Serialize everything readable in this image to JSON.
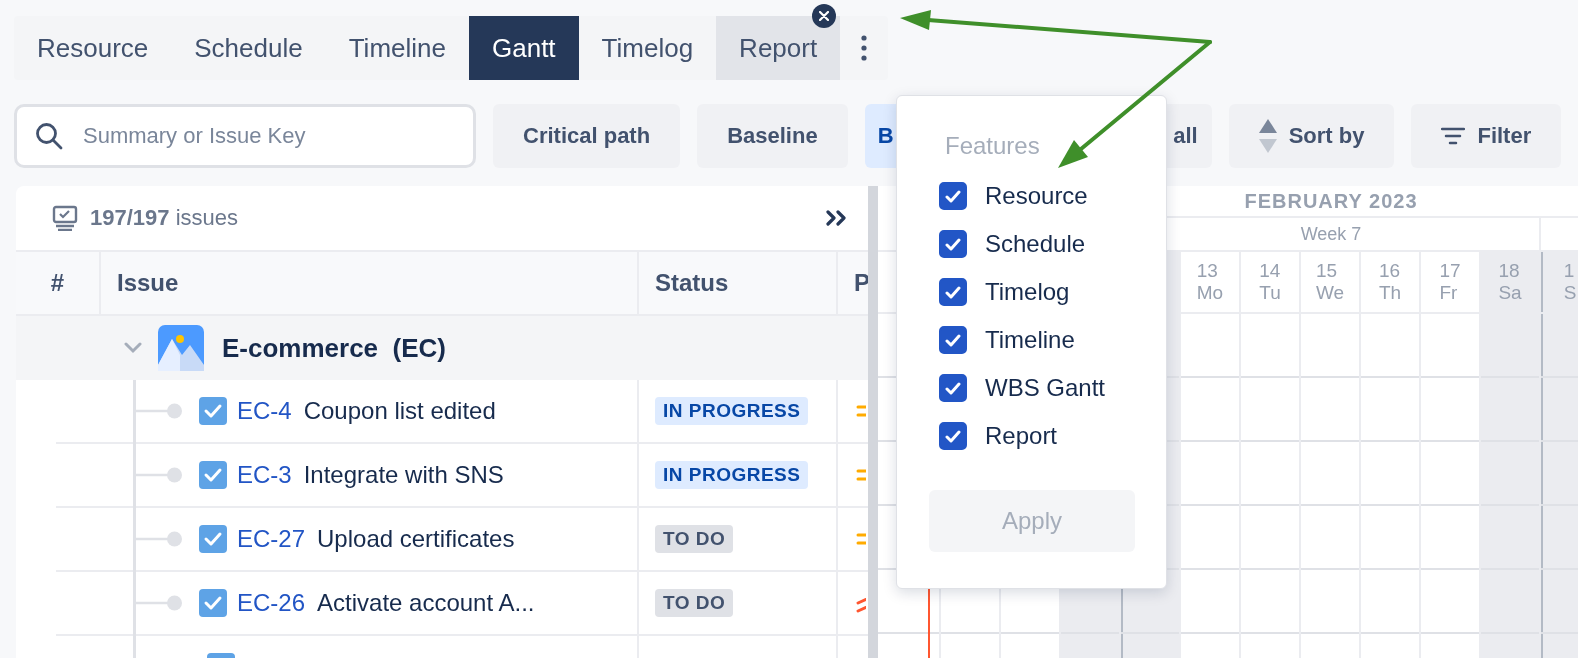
{
  "tabs": [
    {
      "label": "Resource",
      "selected": false,
      "closable": false
    },
    {
      "label": "Schedule",
      "selected": false,
      "closable": false
    },
    {
      "label": "Timeline",
      "selected": false,
      "closable": false
    },
    {
      "label": "Gantt",
      "selected": true,
      "closable": false
    },
    {
      "label": "Timelog",
      "selected": false,
      "closable": false
    },
    {
      "label": "Report",
      "selected": false,
      "closable": true
    }
  ],
  "search": {
    "placeholder": "Summary or Issue Key"
  },
  "toolbar": [
    {
      "label": "Critical path",
      "kind": "plain",
      "active": false
    },
    {
      "label": "Baseline",
      "kind": "plain",
      "active": false
    },
    {
      "label": "B",
      "kind": "cut_end",
      "active": true
    },
    {
      "label": "all",
      "kind": "cut_start",
      "active": false
    },
    {
      "label": "Sort by",
      "kind": "sort",
      "active": false
    },
    {
      "label": "Filter",
      "kind": "filter",
      "active": false
    }
  ],
  "issues_panel": {
    "count": "197/197",
    "count_label": "issues",
    "columns": [
      "#",
      "Issue",
      "Status",
      "P"
    ],
    "group": {
      "name": "E-commerce  (EC)",
      "expanded": true
    },
    "rows": [
      {
        "kind": "task",
        "key": "EC-4",
        "summary": "Coupon list edited",
        "status": {
          "label": "IN PROGRESS",
          "kind": "in_progress"
        },
        "priority": {
          "kind": "medium"
        }
      },
      {
        "kind": "task",
        "key": "EC-3",
        "summary": "Integrate with SNS",
        "status": {
          "label": "IN PROGRESS",
          "kind": "in_progress"
        },
        "priority": {
          "kind": "medium"
        }
      },
      {
        "kind": "task",
        "key": "EC-27",
        "summary": "Upload certificates",
        "status": {
          "label": "TO DO",
          "kind": "todo"
        },
        "priority": {
          "kind": "medium"
        }
      },
      {
        "kind": "task",
        "key": "EC-26",
        "summary": "Activate account A...",
        "status": {
          "label": "TO DO",
          "kind": "todo"
        },
        "priority": {
          "kind": "high"
        }
      },
      {
        "kind": "task"
      }
    ]
  },
  "gantt": {
    "month": "FEBRUARY 2023",
    "week": "Week 7",
    "columns": [
      {
        "weekend": false,
        "week_start": false
      },
      {
        "weekend": false,
        "week_start": false
      },
      {
        "weekend": false,
        "week_start": false
      },
      {
        "weekend": true,
        "week_start": false
      },
      {
        "weekend": true,
        "week_start": true
      },
      {
        "date": "13",
        "weekday": "Mo",
        "weekend": false,
        "week_start": false
      },
      {
        "date": "14",
        "weekday": "Tu",
        "weekend": false,
        "week_start": false
      },
      {
        "date": "15",
        "weekday": "We",
        "weekend": false,
        "week_start": false
      },
      {
        "date": "16",
        "weekday": "Th",
        "weekend": false,
        "week_start": false
      },
      {
        "date": "17",
        "weekday": "Fr",
        "weekend": false,
        "week_start": false
      },
      {
        "date": "18",
        "weekday": "Sa",
        "weekend": true,
        "week_start": false
      },
      {
        "date": "1",
        "weekday": "S",
        "weekend": true,
        "week_start": true
      }
    ]
  },
  "features_menu": {
    "title": "Features",
    "items": [
      {
        "label": "Resource",
        "checked": true
      },
      {
        "label": "Schedule",
        "checked": true
      },
      {
        "label": "Timelog",
        "checked": true
      },
      {
        "label": "Timeline",
        "checked": true
      },
      {
        "label": "WBS Gantt",
        "checked": true
      },
      {
        "label": "Report",
        "checked": true
      }
    ],
    "apply": {
      "label": "Apply",
      "disabled": true
    }
  }
}
